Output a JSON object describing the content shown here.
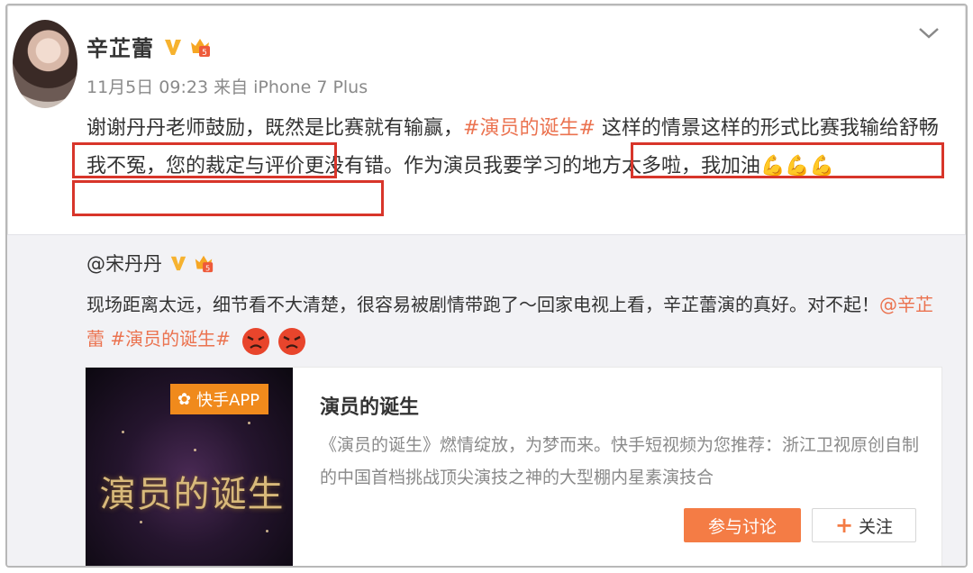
{
  "post": {
    "author": "辛芷蕾",
    "meta": "11月5日 09:23 来自 iPhone 7 Plus",
    "text_part1": "谢谢丹丹老师鼓励，既然是比赛就有输赢，",
    "hashtag": "#演员的诞生#",
    "text_part2": " 这样的情景这样的形式比赛我输给舒畅我不冤，您的裁定与评价更没有错。作为演员我要学习的地方太多啦，我加油",
    "emoji": "💪💪💪"
  },
  "repost": {
    "author": "@宋丹丹",
    "text": "现场距离太远，细节看不大清楚，很容易被剧情带跑了～回家电视上看，辛芷蕾演的真好。对不起！",
    "mention": "@辛芷蕾",
    "hashtag": "#演员的诞生#"
  },
  "card": {
    "badge": "快手APP",
    "thumb_title": "演员的诞生",
    "title": "演员的诞生",
    "description": "《演员的诞生》燃情绽放，为梦而来。快手短视频为您推荐：浙江卫视原创自制的中国首档挑战顶尖演技之神的大型棚内星素演技合",
    "join_label": "参与讨论",
    "follow_label": "关注"
  },
  "icons": {
    "verified": "verified-v-icon",
    "member": "member-badge-icon",
    "collapse": "chevron-down-icon",
    "angry": "angry-face-icon"
  },
  "colors": {
    "accent": "#eb7350",
    "highlight_box": "#d8352a",
    "button_orange": "#f47c45",
    "verified_gold": "#f6b22f"
  }
}
